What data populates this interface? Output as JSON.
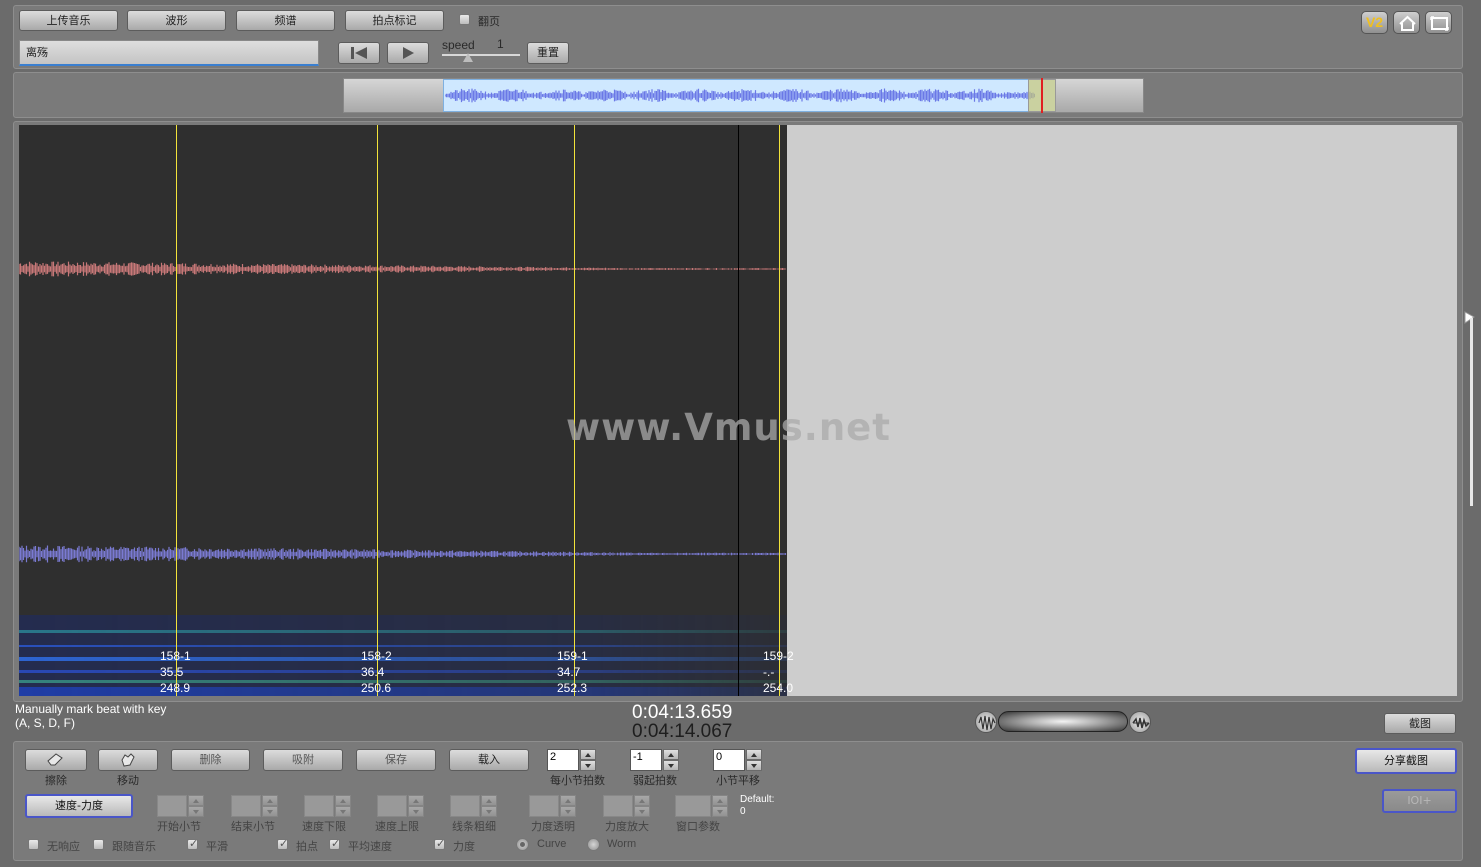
{
  "toolbar": {
    "upload_label": "上传音乐",
    "waveform_label": "波形",
    "spectrum_label": "频谱",
    "beatmark_label": "拍点标记",
    "page_flip_label": "翻页",
    "title_value": "离殇",
    "speed_label": "speed",
    "speed_value": "1",
    "reset_label": "重置"
  },
  "corner_icons": {
    "v2_label": "V2",
    "home_icon": "home-icon",
    "fullscreen_icon": "fullscreen-icon"
  },
  "overview": {
    "wave_color": "#6a78e6",
    "selection_color": "#cfe8ff"
  },
  "main": {
    "watermark": "www.Vmus.net",
    "beats": [
      {
        "label": "158-1",
        "tempo": "35.5",
        "time": "248.9"
      },
      {
        "label": "158-2",
        "tempo": "36.4",
        "time": "250.6"
      },
      {
        "label": "159-1",
        "tempo": "34.7",
        "time": "252.3"
      },
      {
        "label": "159-2",
        "tempo": "-.-",
        "time": "254.0"
      }
    ],
    "wave1_color": "#c87878",
    "wave2_color": "#7a7ad2",
    "beat_color": "#f2e33a"
  },
  "status": {
    "hint_line1": "Manually mark beat with key",
    "hint_line2": "(A, S, D, F)",
    "time_current": "0:04:13.659",
    "time_total": "0:04:14.067",
    "screenshot_label": "截图"
  },
  "controls": {
    "erase_label": "擦除",
    "move_label": "移动",
    "delete_label": "删除",
    "snap_label": "吸附",
    "save_label": "保存",
    "load_label": "载入",
    "beats_per_bar": {
      "value": "2",
      "label": "每小节拍数"
    },
    "pickup_beats": {
      "value": "-1",
      "label": "弱起拍数"
    },
    "bar_offset": {
      "value": "0",
      "label": "小节平移"
    },
    "share_label": "分享截图",
    "tempo_dynamics_label": "速度-力度",
    "ioi_label": "IOI+",
    "params": {
      "start_bar": "开始小节",
      "end_bar": "结束小节",
      "tempo_min": "速度下限",
      "tempo_max": "速度上限",
      "line_width": "线条粗细",
      "dyn_opacity": "力度透明",
      "dyn_zoom": "力度放大",
      "window_param": "窗口参数"
    },
    "default_label": "Default:",
    "default_value": "0",
    "options": {
      "no_labels": "无响应",
      "follow_music": "跟随音乐",
      "smooth": "平滑",
      "beats": "拍点",
      "avg_tempo": "平均速度",
      "dynamics": "力度",
      "curve": "Curve",
      "worm": "Worm"
    }
  }
}
